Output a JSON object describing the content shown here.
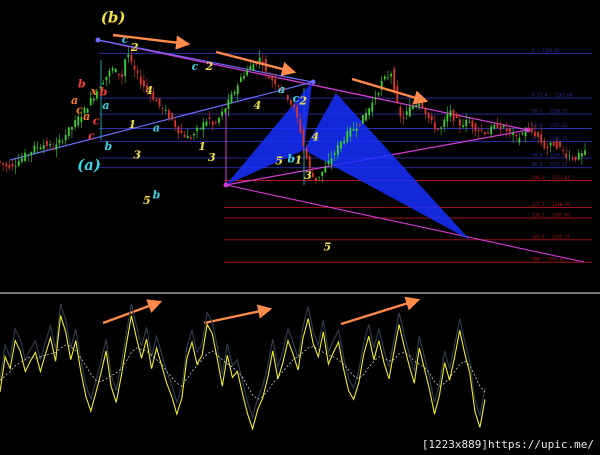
{
  "watermark": "[1223x889]https://upic.me/",
  "colors": {
    "background": "#000000",
    "bull_candle": "#39d12c",
    "bear_candle": "#e0372a",
    "wave_label_yellow": "#f2e04a",
    "wave_label_cyan": "#38d3e6",
    "wave_label_orange": "#ff7a1c",
    "wave_label_red": "#ff3b3b",
    "channel_magenta": "#d63ad6",
    "trend_blue": "#6a6cff",
    "harmonic_fill": "#1630ff",
    "arrow_orange": "#ff8a4a",
    "oscillator_main": "#f1ee2a",
    "oscillator_signal": "#ffffff",
    "fib_blue": "#2c31a8",
    "fib_red": "#b31515"
  },
  "chart_data": [
    {
      "type": "candlestick",
      "title": "",
      "xlabel": "",
      "ylabel": "",
      "ylim": [
        1240.0,
        1270.0
      ],
      "grid": false,
      "fib_levels": [
        {
          "label": "0 · 1266.04",
          "value": 1266.04,
          "color": "blue"
        },
        {
          "label": "0.23.6 · 1261.04",
          "value": 1261.04,
          "color": "blue"
        },
        {
          "label": "38.2 · 1259.25",
          "value": 1259.25,
          "color": "blue"
        },
        {
          "label": "50.0 · 1257.63",
          "value": 1257.63,
          "color": "blue"
        },
        {
          "label": "61.8 · 1256.19",
          "value": 1256.19,
          "color": "blue"
        },
        {
          "label": "78.6 · 1254.32",
          "value": 1254.32,
          "color": "blue"
        },
        {
          "label": "88.6 · 1253.24",
          "value": 1253.24,
          "color": "blue"
        },
        {
          "label": "100.0 · 1251.81",
          "value": 1251.81,
          "color": "red"
        },
        {
          "label": "127.2 · 1248.79",
          "value": 1248.79,
          "color": "red"
        },
        {
          "label": "138.2 · 1247.60",
          "value": 1247.6,
          "color": "red"
        },
        {
          "label": "161.8 · 1245.17",
          "value": 1245.17,
          "color": "red"
        },
        {
          "label": "200 · 1242.66",
          "value": 1242.66,
          "color": "red"
        }
      ],
      "price_path": [
        [
          0,
          1254.0
        ],
        [
          4,
          1253.4
        ],
        [
          8,
          1253.8
        ],
        [
          12,
          1254.6
        ],
        [
          16,
          1255.5
        ],
        [
          20,
          1255.9
        ],
        [
          24,
          1255.4
        ],
        [
          28,
          1256.8
        ],
        [
          32,
          1258.1
        ],
        [
          36,
          1259.5
        ],
        [
          40,
          1261.2
        ],
        [
          44,
          1263.0
        ],
        [
          48,
          1264.3
        ],
        [
          52,
          1263.5
        ],
        [
          54,
          1266.5
        ],
        [
          56,
          1264.6
        ],
        [
          60,
          1262.8
        ],
        [
          64,
          1261.5
        ],
        [
          68,
          1260.0
        ],
        [
          72,
          1258.9
        ],
        [
          76,
          1257.2
        ],
        [
          80,
          1256.5
        ],
        [
          84,
          1257.6
        ],
        [
          88,
          1258.8
        ],
        [
          90,
          1257.8
        ],
        [
          94,
          1259.5
        ],
        [
          98,
          1261.4
        ],
        [
          102,
          1263.6
        ],
        [
          106,
          1264.7
        ],
        [
          110,
          1265.6
        ],
        [
          112,
          1263.6
        ],
        [
          116,
          1262.8
        ],
        [
          120,
          1261.6
        ],
        [
          124,
          1259.5
        ],
        [
          126,
          1257.5
        ],
        [
          128,
          1255.0
        ],
        [
          130,
          1253.0
        ],
        [
          132,
          1251.8
        ],
        [
          136,
          1253.0
        ],
        [
          140,
          1254.8
        ],
        [
          144,
          1256.5
        ],
        [
          148,
          1257.6
        ],
        [
          152,
          1258.7
        ],
        [
          156,
          1260.5
        ],
        [
          160,
          1262.8
        ],
        [
          164,
          1264.0
        ],
        [
          166,
          1260.6
        ],
        [
          168,
          1258.5
        ],
        [
          172,
          1260.0
        ],
        [
          176,
          1260.8
        ],
        [
          180,
          1258.4
        ],
        [
          184,
          1257.3
        ],
        [
          188,
          1259.5
        ],
        [
          192,
          1258.1
        ],
        [
          196,
          1258.4
        ],
        [
          200,
          1257.5
        ],
        [
          204,
          1257.2
        ],
        [
          208,
          1258.0
        ],
        [
          212,
          1257.4
        ],
        [
          216,
          1256.4
        ],
        [
          220,
          1257.5
        ],
        [
          224,
          1257.0
        ],
        [
          228,
          1255.4
        ],
        [
          232,
          1256.0
        ],
        [
          236,
          1254.8
        ],
        [
          240,
          1254.3
        ],
        [
          244,
          1254.8
        ]
      ],
      "annotations": [
        {
          "text": "(b)",
          "x": 47,
          "y": 1269.5,
          "color": "yellow"
        },
        {
          "text": "c",
          "x": 52,
          "y": 1267.2,
          "color": "cyan"
        },
        {
          "text": "2",
          "x": 56,
          "y": 1266.3,
          "color": "yellow"
        },
        {
          "text": "b",
          "x": 34,
          "y": 1262.2,
          "color": "red"
        },
        {
          "text": "x",
          "x": 39,
          "y": 1261.4,
          "color": "orange"
        },
        {
          "text": "b",
          "x": 43,
          "y": 1261.3,
          "color": "red"
        },
        {
          "text": "a",
          "x": 31,
          "y": 1260.4,
          "color": "orange"
        },
        {
          "text": "c",
          "x": 33,
          "y": 1259.3,
          "color": "orange"
        },
        {
          "text": "a",
          "x": 36,
          "y": 1258.6,
          "color": "orange"
        },
        {
          "text": "a",
          "x": 44,
          "y": 1259.8,
          "color": "cyan"
        },
        {
          "text": "c",
          "x": 40,
          "y": 1258.1,
          "color": "red"
        },
        {
          "text": "c",
          "x": 38,
          "y": 1256.4,
          "color": "red"
        },
        {
          "text": "b",
          "x": 45,
          "y": 1255.2,
          "color": "cyan"
        },
        {
          "text": "1",
          "x": 55,
          "y": 1257.7,
          "color": "yellow"
        },
        {
          "text": "4",
          "x": 62,
          "y": 1261.5,
          "color": "yellow"
        },
        {
          "text": "3",
          "x": 57,
          "y": 1254.3,
          "color": "yellow"
        },
        {
          "text": "(a)",
          "x": 37,
          "y": 1253.0,
          "color": "cyan"
        },
        {
          "text": "a",
          "x": 65,
          "y": 1257.3,
          "color": "cyan"
        },
        {
          "text": "c",
          "x": 81,
          "y": 1264.2,
          "color": "cyan"
        },
        {
          "text": "2",
          "x": 87,
          "y": 1264.2,
          "color": "yellow"
        },
        {
          "text": "1",
          "x": 84,
          "y": 1255.2,
          "color": "yellow"
        },
        {
          "text": "3",
          "x": 88,
          "y": 1254.0,
          "color": "yellow"
        },
        {
          "text": "5",
          "x": 61,
          "y": 1249.2,
          "color": "yellow"
        },
        {
          "text": "b",
          "x": 65,
          "y": 1249.8,
          "color": "cyan"
        },
        {
          "text": "a",
          "x": 117,
          "y": 1261.6,
          "color": "cyan"
        },
        {
          "text": "4",
          "x": 107,
          "y": 1259.8,
          "color": "yellow"
        },
        {
          "text": "c",
          "x": 123,
          "y": 1260.6,
          "color": "cyan"
        },
        {
          "text": "2",
          "x": 126,
          "y": 1260.3,
          "color": "yellow"
        },
        {
          "text": "4",
          "x": 131,
          "y": 1256.3,
          "color": "yellow"
        },
        {
          "text": "5",
          "x": 116,
          "y": 1253.6,
          "color": "yellow"
        },
        {
          "text": "b",
          "x": 121,
          "y": 1253.8,
          "color": "cyan"
        },
        {
          "text": "1",
          "x": 124,
          "y": 1253.7,
          "color": "yellow"
        },
        {
          "text": "3",
          "x": 128,
          "y": 1252.0,
          "color": "yellow"
        },
        {
          "text": "5",
          "x": 136,
          "y": 1244.0,
          "color": "yellow"
        }
      ]
    },
    {
      "type": "line",
      "title": "",
      "ylim": [
        0,
        100
      ],
      "series": [
        {
          "values": [
            36,
            60,
            52,
            71,
            64,
            50,
            57,
            63,
            50,
            62,
            73,
            57,
            88,
            77,
            58,
            71,
            50,
            33,
            23,
            36,
            49,
            64,
            40,
            29,
            47,
            68,
            88,
            73,
            59,
            72,
            52,
            66,
            54,
            42,
            33,
            21,
            32,
            59,
            70,
            55,
            61,
            82,
            76,
            59,
            40,
            61,
            46,
            50,
            35,
            21,
            11,
            24,
            32,
            46,
            64,
            45,
            56,
            71,
            62,
            51,
            73,
            86,
            69,
            60,
            77,
            55,
            63,
            70,
            52,
            37,
            31,
            42,
            62,
            74,
            58,
            71,
            56,
            45,
            64,
            82,
            67,
            54,
            42,
            66,
            52,
            38,
            21,
            34,
            56,
            44,
            60,
            78,
            62,
            49,
            23,
            12,
            31
          ]
        },
        {
          "values": [
            44,
            47,
            50,
            54,
            56,
            58,
            60,
            59,
            60,
            61,
            62,
            63,
            66,
            68,
            67,
            64,
            59,
            54,
            48,
            44,
            43,
            45,
            47,
            49,
            52,
            57,
            63,
            66,
            65,
            64,
            61,
            58,
            55,
            50,
            46,
            42,
            40,
            45,
            50,
            54,
            58,
            62,
            64,
            61,
            58,
            55,
            53,
            50,
            46,
            40,
            34,
            31,
            33,
            37,
            42,
            46,
            50,
            54,
            58,
            60,
            63,
            66,
            67,
            65,
            63,
            61,
            60,
            58,
            55,
            51,
            47,
            45,
            48,
            53,
            57,
            60,
            59,
            57,
            58,
            62,
            63,
            61,
            57,
            55,
            53,
            49,
            43,
            40,
            42,
            46,
            50,
            55,
            57,
            54,
            47,
            40,
            36
          ]
        }
      ]
    }
  ]
}
